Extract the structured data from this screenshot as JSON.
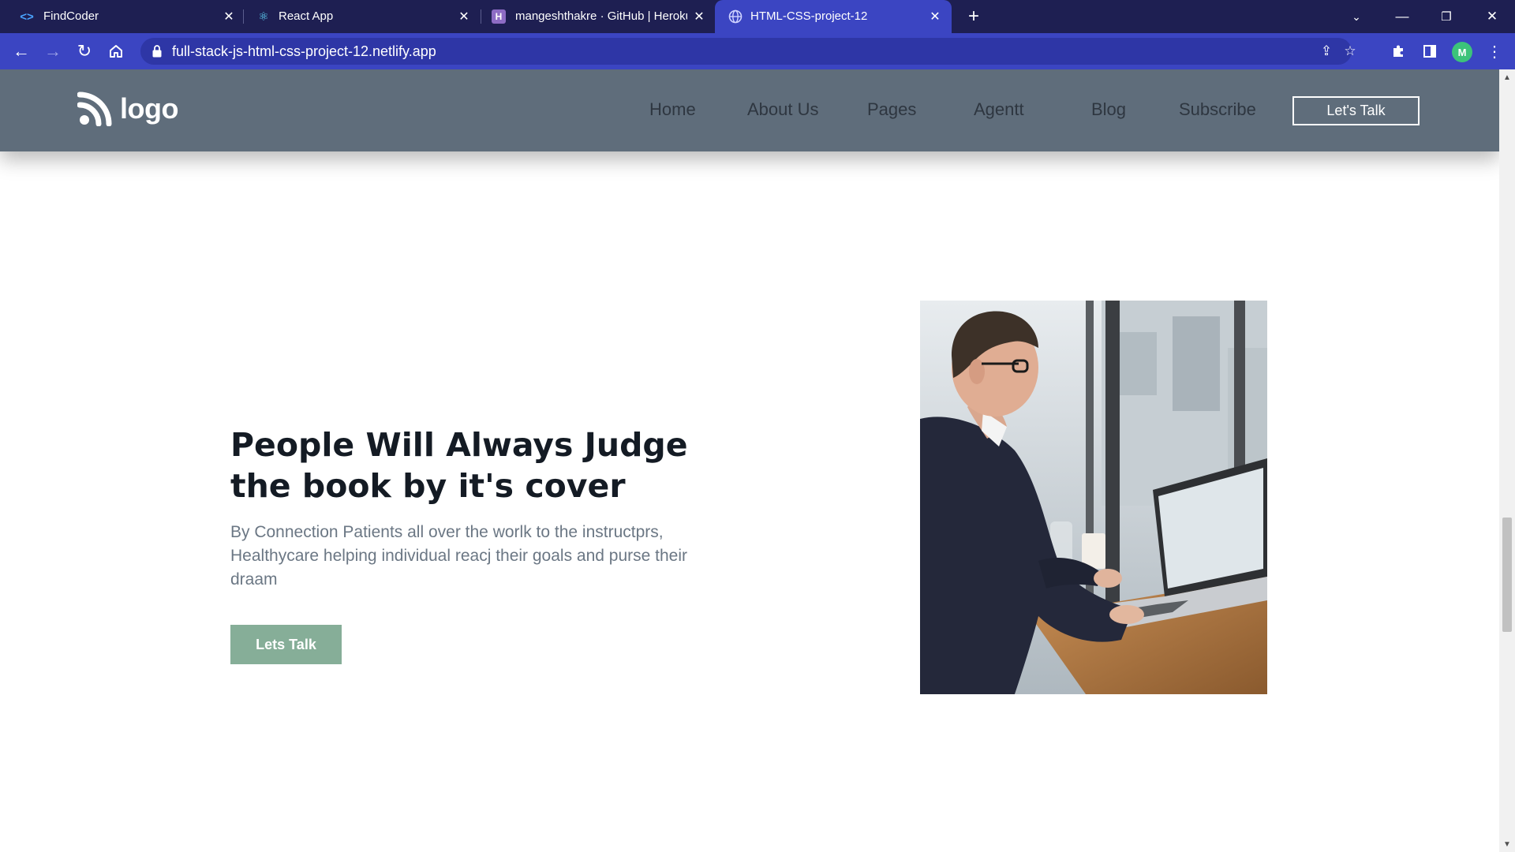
{
  "browser": {
    "tabs": [
      {
        "title": "FindCoder",
        "favicon": "code-brackets-icon",
        "active": false
      },
      {
        "title": "React App",
        "favicon": "react-atom-icon",
        "active": false
      },
      {
        "title": "mangeshthakre · GitHub | Heroku",
        "favicon": "heroku-icon",
        "active": false
      },
      {
        "title": "HTML-CSS-project-12",
        "favicon": "globe-icon",
        "active": true
      }
    ],
    "url": "full-stack-js-html-css-project-12.netlify.app",
    "avatar_letter": "M",
    "colors": {
      "tabbar": "#1e1f52",
      "toolbar": "#3b45c2",
      "active_tab": "#3b45c2"
    }
  },
  "site": {
    "logo_text": "logo",
    "nav": [
      "Home",
      "About Us",
      "Pages",
      "Agentt",
      "Blog",
      "Subscribe"
    ],
    "nav_cta": "Let's Talk",
    "hero": {
      "title": "People Will Always Judge the book by it's cover",
      "text": "By Connection Patients all over the worlk to the instructprs, Healthycare helping individual reacj their goals and purse their draam",
      "button": "Lets Talk",
      "image": "man-working-on-laptop-photo"
    },
    "colors": {
      "header_bg": "#5f6d7b",
      "accent_button": "#86ae98",
      "title": "#141b24",
      "body_text": "#6b7784"
    }
  }
}
